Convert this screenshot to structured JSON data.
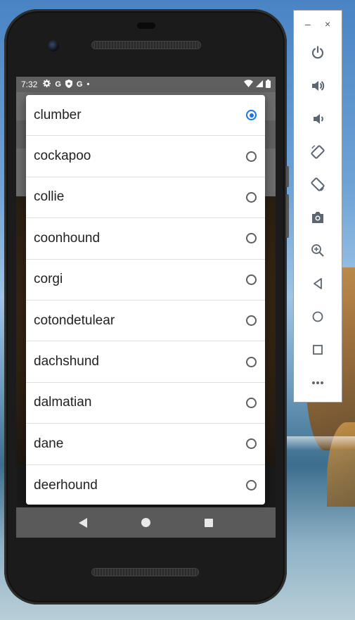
{
  "status_bar": {
    "time": "7:32",
    "icons": [
      "gear-icon",
      "google-icon",
      "shield-icon",
      "google-icon",
      "dot-icon"
    ],
    "right_icons": [
      "wifi-icon",
      "signal-icon",
      "battery-icon"
    ]
  },
  "dialog": {
    "options": [
      {
        "label": "clumber",
        "selected": true
      },
      {
        "label": "cockapoo",
        "selected": false
      },
      {
        "label": "collie",
        "selected": false
      },
      {
        "label": "coonhound",
        "selected": false
      },
      {
        "label": "corgi",
        "selected": false
      },
      {
        "label": "cotondetulear",
        "selected": false
      },
      {
        "label": "dachshund",
        "selected": false
      },
      {
        "label": "dalmatian",
        "selected": false
      },
      {
        "label": "dane",
        "selected": false
      },
      {
        "label": "deerhound",
        "selected": false
      }
    ]
  },
  "nav_bar": {
    "icons": [
      "back-icon",
      "home-icon",
      "recents-icon"
    ]
  },
  "emulator_toolbar": {
    "window_controls": {
      "minimize": "–",
      "close": "×"
    },
    "buttons": [
      "power-icon",
      "volume-up-icon",
      "volume-down-icon",
      "rotate-left-icon",
      "rotate-right-icon",
      "camera-icon",
      "zoom-icon",
      "back-icon",
      "home-icon",
      "overview-icon",
      "more-icon"
    ]
  },
  "colors": {
    "accent": "#1a73e8",
    "status_bar": "#5f5f5f",
    "nav_bar": "#5a5a5a"
  }
}
